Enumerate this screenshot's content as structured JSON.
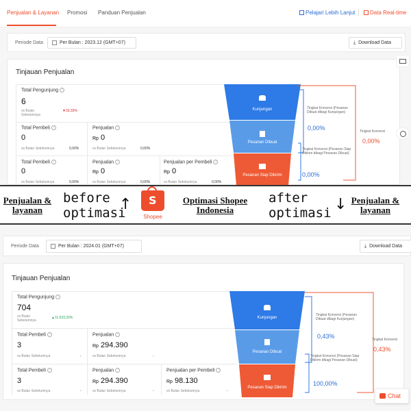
{
  "topnav": {
    "tabs": [
      "Penjualan & Layanan",
      "Promosi",
      "Panduan Penjualan"
    ],
    "learn_more": "Pelajari Lebih Lanjut",
    "realtime": "Data Real-time"
  },
  "colors": {
    "accent": "#ee4d2d",
    "link": "#2b6cd3",
    "funnel_top": "#2e7ae6",
    "funnel_mid": "#5a9be8",
    "funnel_bottom": "#ee5a35"
  },
  "before": {
    "period_label": "Periode Data",
    "period_value": "Per Bulan : 2023.12 (GMT+07)",
    "download": "Download Data",
    "section_title": "Tinjauan Penjualan",
    "visitors": {
      "title": "Total Pengunjung",
      "value": "6",
      "sub": "vs Bulan Sebelumnya",
      "change": "▼33,33%"
    },
    "buyers": {
      "title": "Total Pembeli",
      "value": "0",
      "sub": "vs Bulan Sebelumnya",
      "change": "0,00%"
    },
    "sales": {
      "title": "Penjualan",
      "currency": "Rp",
      "value": "0",
      "sub": "vs Bulan Sebelumnya",
      "change": "0,00%"
    },
    "buyers2": {
      "title": "Total Pembeli",
      "value": "0",
      "sub": "vs Bulan Sebelumnya",
      "change": "0,00%"
    },
    "sales2": {
      "title": "Penjualan",
      "currency": "Rp",
      "value": "0",
      "sub": "vs Bulan Sebelumnya",
      "change": "0,00%"
    },
    "per_buyer": {
      "title": "Penjualan per Pembeli",
      "currency": "Rp",
      "value": "0",
      "sub": "vs Bulan Sebelumnya",
      "change": "0,00%"
    },
    "funnel": {
      "top": "Kunjungan",
      "mid": "Pesanan Dibuat",
      "bottom": "Pesanan Siap Dikirim"
    },
    "conv1": {
      "label": "Tingkat Konversi (Pesanan Dibuat dibagi Kunjungan)",
      "value": "0,00%"
    },
    "conv2": {
      "label": "Tingkat Konversi (Pesanan Siap Dikirim dibagi Pesanan Dibuat)",
      "value": "0,00%"
    },
    "conv_total": {
      "label": "Tingkat Konversi",
      "value": "0,00%"
    }
  },
  "banner": {
    "left_link": "Penjualan & layanan",
    "before_text": "before optimasi",
    "up_arrow": "↑",
    "shopee": "Shopee",
    "center_link": "Optimasi Shopee Indonesia",
    "after_text": "after optimasi",
    "down_arrow": "↓",
    "right_link": "Penjualan & layanan"
  },
  "after": {
    "period_label": "Periode Data",
    "period_value": "Per Bulan : 2024.01 (GMT+07)",
    "download": "Download Data",
    "section_title": "Tinjauan Penjualan",
    "visitors": {
      "title": "Total Pengunjung",
      "value": "704",
      "sub": "vs Bulan Sebelumnya",
      "change": "▲11.633,33%"
    },
    "buyers": {
      "title": "Total Pembeli",
      "value": "3",
      "sub": "vs Bulan Sebelumnya",
      "change": "-"
    },
    "sales": {
      "title": "Penjualan",
      "currency": "Rp",
      "value": "294.390",
      "sub": "vs Bulan Sebelumnya",
      "change": "-"
    },
    "buyers2": {
      "title": "Total Pembeli",
      "value": "3",
      "sub": "vs Bulan Sebelumnya",
      "change": "-"
    },
    "sales2": {
      "title": "Penjualan",
      "currency": "Rp",
      "value": "294.390",
      "sub": "vs Bulan Sebelumnya",
      "change": "-"
    },
    "per_buyer": {
      "title": "Penjualan per Pembeli",
      "currency": "Rp",
      "value": "98.130",
      "sub": "vs Bulan Sebelumnya",
      "change": "-"
    },
    "funnel": {
      "top": "Kunjungan",
      "mid": "Pesanan Dibuat",
      "bottom": "Pesanan Siap Dikirim"
    },
    "conv1": {
      "label": "Tingkat Konversi (Pesanan Dibuat dibagi Kunjungan)",
      "value": "0,43%"
    },
    "conv2": {
      "label": "Tingkat Konversi (Pesanan Siap Dikirim dibagi Pesanan Dibuat)",
      "value": "100,00%"
    },
    "conv_total": {
      "label": "Tingkat Konversi",
      "value": "0,43%"
    }
  },
  "chat": {
    "label": "Chat"
  }
}
